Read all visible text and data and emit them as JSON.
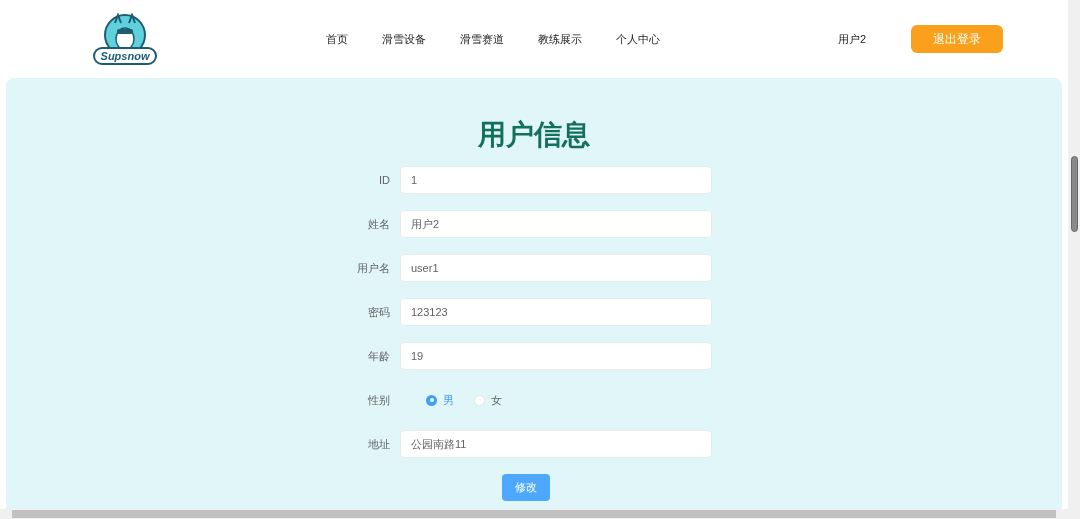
{
  "header": {
    "logo_text": "Supsnow",
    "nav": [
      {
        "label": "首页"
      },
      {
        "label": "滑雪设备"
      },
      {
        "label": "滑雪赛道"
      },
      {
        "label": "教练展示"
      },
      {
        "label": "个人中心"
      }
    ],
    "user": "用户2",
    "logout": "退出登录"
  },
  "form": {
    "title": "用户信息",
    "fields": [
      {
        "kind": "text",
        "label": "ID",
        "value": "1"
      },
      {
        "kind": "text",
        "label": "姓名",
        "value": "用户2"
      },
      {
        "kind": "text",
        "label": "用户名",
        "value": "user1"
      },
      {
        "kind": "text",
        "label": "密码",
        "value": "123123"
      },
      {
        "kind": "text",
        "label": "年龄",
        "value": "19"
      },
      {
        "kind": "radio",
        "label": "性别",
        "options": [
          {
            "label": "男",
            "selected": true
          },
          {
            "label": "女",
            "selected": false
          }
        ]
      },
      {
        "kind": "text",
        "label": "地址",
        "value": "公园南路11"
      }
    ],
    "submit": "修改"
  }
}
